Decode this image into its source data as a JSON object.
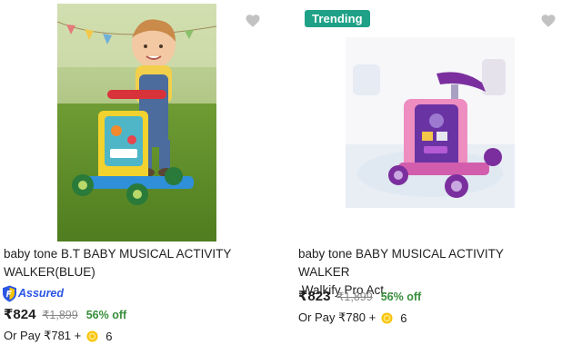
{
  "products": [
    {
      "title_line1": "baby tone B.T BABY MUSICAL ACTIVITY",
      "title_line2": "WALKER(BLUE)",
      "assured_label": "Assured",
      "price": "₹824",
      "mrp": "₹1,899",
      "discount": "56% off",
      "pay_prefix": "Or Pay ₹781 +",
      "coins": "6",
      "wishlist_icon": "heart-icon"
    },
    {
      "badge": "Trending",
      "title_line1": "baby tone BABY MUSICAL ACTIVITY WALKER",
      "title_line2": ",Walkify Pro Act...",
      "price": "₹823",
      "mrp": "₹1,899",
      "discount": "56% off",
      "pay_prefix": "Or Pay ₹780 +",
      "coins": "6",
      "wishlist_icon": "heart-icon"
    }
  ],
  "colors": {
    "trending_badge": "#1fa187",
    "discount": "#388e3c",
    "assured": "#2a55e5",
    "heart": "#c2c2c2"
  }
}
